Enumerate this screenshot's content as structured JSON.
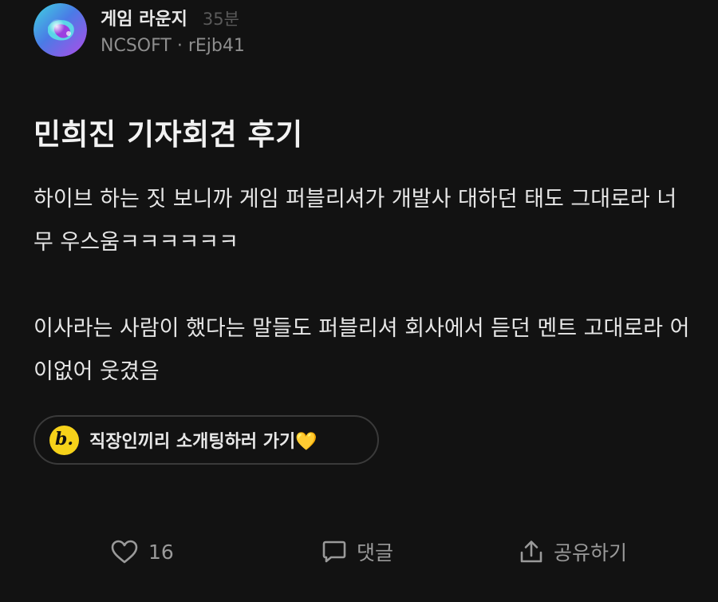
{
  "post_header": {
    "lounge_name": "게임 라운지",
    "time_ago": "35분",
    "company": "NCSOFT",
    "separator": "·",
    "user_id": "rEjb41",
    "avatar_icon": "lounge-avatar-icon"
  },
  "post": {
    "title": "민희진 기자회견 후기",
    "paragraphs": [
      "하이브 하는 짓 보니까 게임 퍼블리셔가 개발사 대하던 태도 그대로라 너무 우스움ㅋㅋㅋㅋㅋㅋ",
      "이사라는 사람이 했다는 말들도 퍼블리셔 회사에서 듣던 멘트 고대로라 어이없어 웃겼음"
    ]
  },
  "promo": {
    "logo_letter": "b.",
    "text": "직장인끼리 소개팅하러 가기💛",
    "logo_color": "#f6d21a"
  },
  "actions": {
    "like_count": "16",
    "like_icon": "heart-outline-icon",
    "comment_label": "댓글",
    "comment_icon": "chat-bubble-icon",
    "share_label": "공유하기",
    "share_icon": "share-icon"
  },
  "colors": {
    "background": "#121212",
    "primary_text": "#e6e6e6",
    "secondary_text": "#8e8e8e",
    "muted_text": "#5a5a5a",
    "action_text": "#9a9a9a"
  }
}
